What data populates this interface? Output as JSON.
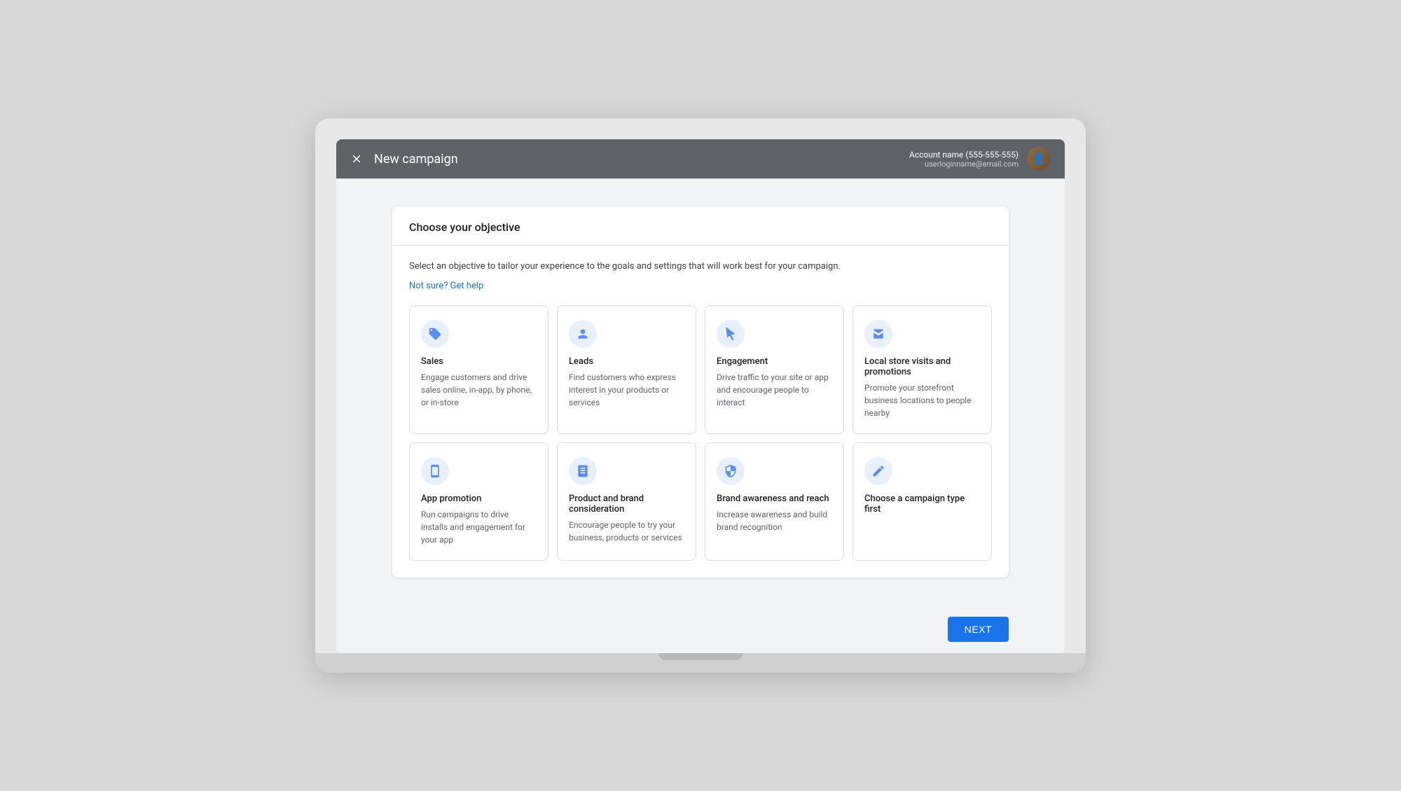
{
  "header": {
    "title": "New campaign",
    "close_icon": "×",
    "account_name": "Account name (555-555-555)",
    "account_email": "userloginname@email.com"
  },
  "card": {
    "title": "Choose your objective",
    "description": "Select an objective to tailor your experience to the goals and settings that will work best for your campaign.",
    "help_text": "Not sure? Get help"
  },
  "options": [
    {
      "id": "sales",
      "title": "Sales",
      "description": "Engage customers and drive sales online, in-app, by phone, or in-store",
      "icon": "tag"
    },
    {
      "id": "leads",
      "title": "Leads",
      "description": "Find customers who express interest in your products or services",
      "icon": "person"
    },
    {
      "id": "engagement",
      "title": "Engagement",
      "description": "Drive traffic to your site or app and encourage people to interact",
      "icon": "cursor"
    },
    {
      "id": "local-store",
      "title": "Local store visits and promotions",
      "description": "Promote your storefront business locations to people nearby",
      "icon": "store"
    },
    {
      "id": "app-promotion",
      "title": "App promotion",
      "description": "Run campaigns to drive installs and engagement for your app",
      "icon": "phone"
    },
    {
      "id": "product-brand",
      "title": "Product and brand consideration",
      "description": "Encourage people to try your business, products or services",
      "icon": "book"
    },
    {
      "id": "brand-awareness",
      "title": "Brand awareness and reach",
      "description": "Increase awareness and build brand recognition",
      "icon": "shield"
    },
    {
      "id": "choose-type",
      "title": "Choose a campaign type first",
      "description": "",
      "icon": "pencil"
    }
  ],
  "footer": {
    "next_button": "NEXT"
  }
}
